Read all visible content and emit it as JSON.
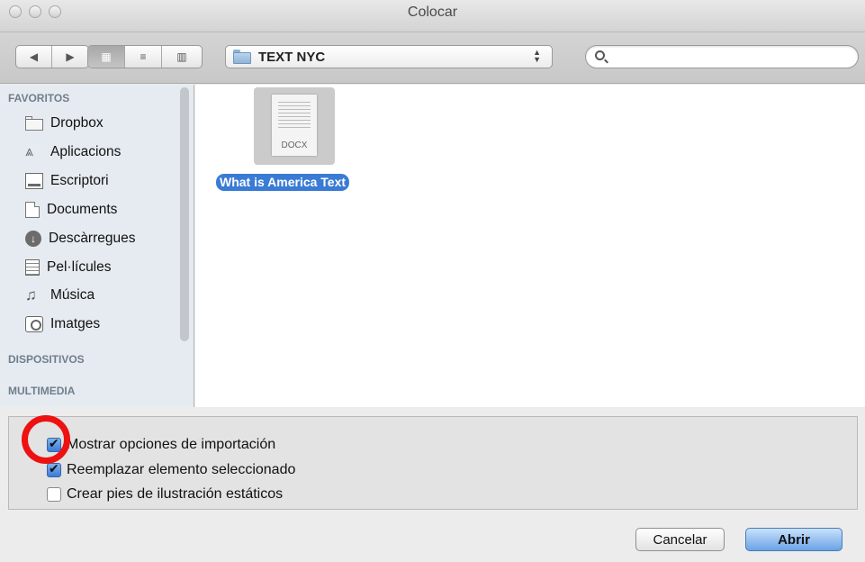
{
  "window": {
    "title": "Colocar"
  },
  "toolbar": {
    "back_icon": "◀",
    "forward_icon": "▶",
    "view_icon_grid": "▦",
    "view_icon_list": "≡",
    "view_icon_columns": "▥",
    "path_label": "TEXT NYC",
    "search_placeholder": ""
  },
  "sidebar": {
    "favorites_label": "FAVORITOS",
    "items": [
      {
        "label": "Dropbox",
        "icon": "folder-icon"
      },
      {
        "label": "Aplicacions",
        "icon": "applications-icon"
      },
      {
        "label": "Escriptori",
        "icon": "desktop-icon"
      },
      {
        "label": "Documents",
        "icon": "documents-icon"
      },
      {
        "label": "Descàrregues",
        "icon": "downloads-icon"
      },
      {
        "label": "Pel·lícules",
        "icon": "movies-icon"
      },
      {
        "label": "Música",
        "icon": "music-icon"
      },
      {
        "label": "Imatges",
        "icon": "pictures-icon"
      }
    ],
    "devices_label": "DISPOSITIVOS",
    "media_label": "MULTIMEDIA"
  },
  "files": [
    {
      "name": "What is America Text",
      "type": "DOCX",
      "selected": true
    }
  ],
  "options": [
    {
      "label": "Mostrar opciones de importación",
      "checked": true
    },
    {
      "label": "Reemplazar elemento seleccionado",
      "checked": true
    },
    {
      "label": "Crear pies de ilustración estáticos",
      "checked": false
    }
  ],
  "buttons": {
    "cancel": "Cancelar",
    "open": "Abrir"
  },
  "colors": {
    "accent": "#3a7bd5",
    "annotation": "#ee1111"
  }
}
